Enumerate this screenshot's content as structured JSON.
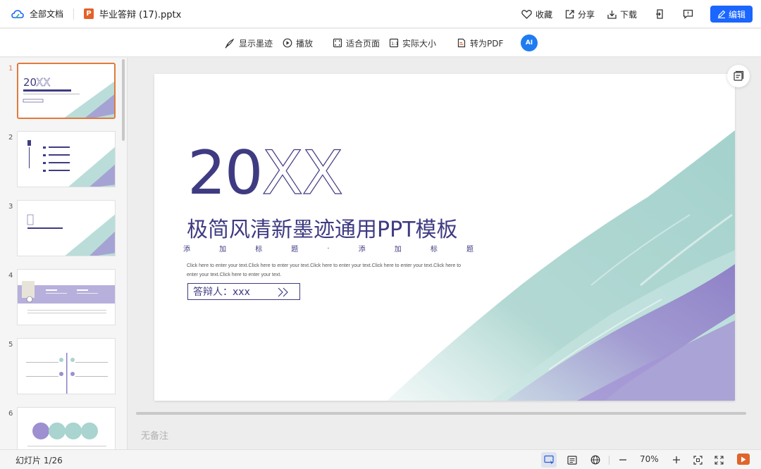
{
  "topbar": {
    "home_label": "全部文档",
    "file_icon_letter": "P",
    "file_name": "毕业答辩 (17).pptx",
    "favorite_label": "收藏",
    "share_label": "分享",
    "download_label": "下载",
    "edit_label": "编辑"
  },
  "toolbar": {
    "show_ink_label": "显示墨迹",
    "play_label": "播放",
    "fit_page_label": "适合页面",
    "actual_size_label": "实际大小",
    "to_pdf_label": "转为PDF",
    "ai_label": "AI"
  },
  "sidebar": {
    "thumbnails": [
      {
        "number": "1",
        "active": true
      },
      {
        "number": "2",
        "active": false
      },
      {
        "number": "3",
        "active": false
      },
      {
        "number": "4",
        "active": false
      },
      {
        "number": "5",
        "active": false
      },
      {
        "number": "6",
        "active": false
      }
    ]
  },
  "slide": {
    "year_solid": "20",
    "year_outline": "XX",
    "title": "极简风清新墨迹通用PPT模板",
    "subtitle_chars": [
      "添",
      "加",
      "标",
      "题",
      ".",
      "添",
      "加",
      "标",
      "题"
    ],
    "body_text": "Click here to enter your text.Click here to enter your text.Click here to enter your text.Click here to enter your text.Click here to enter your text.Click here to enter your text.",
    "presenter_label": "答辩人：xxx"
  },
  "notes_placeholder": "无备注",
  "statusbar": {
    "slide_counter": "幻灯片 1/26",
    "zoom": "70%"
  },
  "colors": {
    "accent": "#1a66ff",
    "slide_purple": "#3f3b82",
    "ink_teal": "#9fcfca",
    "ink_violet": "#9d8fd0",
    "thumb_active_border": "#e07a3c",
    "ppt_orange": "#e2622a"
  }
}
